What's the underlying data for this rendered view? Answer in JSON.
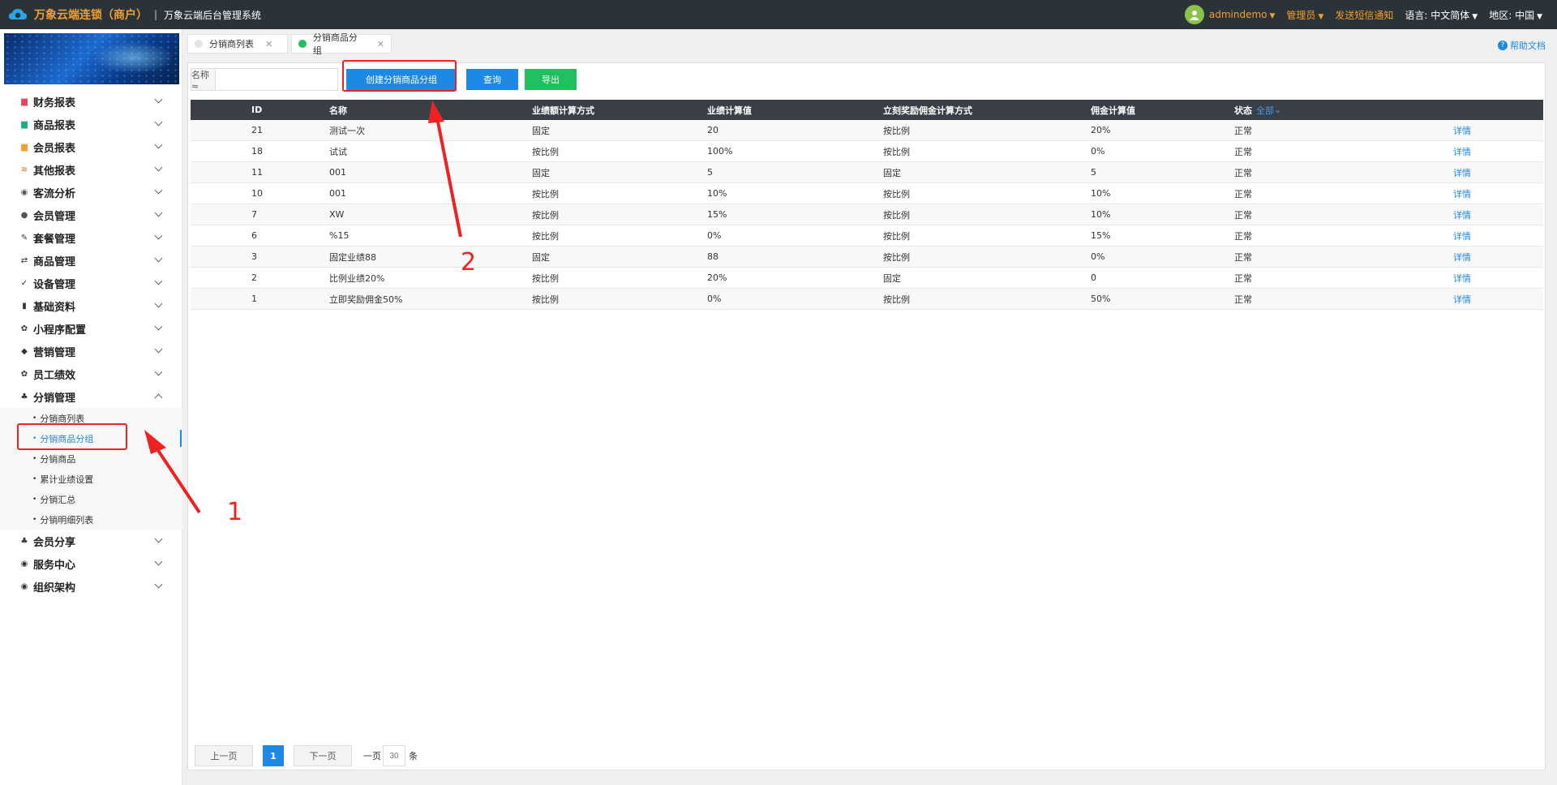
{
  "app": {
    "brand": "万象云端连锁（商户）",
    "separator": "|",
    "system_name": "万象云端后台管理系统"
  },
  "topbar": {
    "user": "admindemo",
    "role": "管理员",
    "sms_notice": "发送短信通知",
    "language_label": "语言:",
    "language_value": "中文简体",
    "region_label": "地区:",
    "region_value": "中国"
  },
  "sidebar": {
    "items": [
      {
        "label": "财务报表",
        "icon": "finance-report-icon"
      },
      {
        "label": "商品报表",
        "icon": "product-report-icon"
      },
      {
        "label": "会员报表",
        "icon": "member-report-icon"
      },
      {
        "label": "其他报表",
        "icon": "other-report-icon"
      },
      {
        "label": "客流分析",
        "icon": "traffic-analysis-icon"
      },
      {
        "label": "会员管理",
        "icon": "member-manage-icon"
      },
      {
        "label": "套餐管理",
        "icon": "package-manage-icon"
      },
      {
        "label": "商品管理",
        "icon": "product-manage-icon"
      },
      {
        "label": "设备管理",
        "icon": "device-manage-icon"
      },
      {
        "label": "基础资料",
        "icon": "basic-data-icon"
      },
      {
        "label": "小程序配置",
        "icon": "miniapp-config-icon"
      },
      {
        "label": "营销管理",
        "icon": "marketing-icon"
      },
      {
        "label": "员工绩效",
        "icon": "staff-performance-icon"
      },
      {
        "label": "分销管理",
        "icon": "distribution-icon"
      }
    ],
    "sub_items": [
      "分销商列表",
      "分销商品分组",
      "分销商品",
      "累计业绩设置",
      "分销汇总",
      "分销明细列表"
    ],
    "after_items": [
      {
        "label": "会员分享",
        "icon": "member-share-icon"
      },
      {
        "label": "服务中心",
        "icon": "service-center-icon"
      },
      {
        "label": "组织架构",
        "icon": "org-structure-icon"
      }
    ]
  },
  "tabs": [
    {
      "label": "分销商列表"
    },
    {
      "label": "分销商品分组"
    }
  ],
  "help": "帮助文档",
  "toolbar": {
    "search_label": "名称 ≈",
    "search_value": "",
    "create_label": "创建分销商品分组",
    "query_label": "查询",
    "export_label": "导出"
  },
  "table": {
    "columns": [
      "ID",
      "名称",
      "业绩额计算方式",
      "业绩计算值",
      "立刻奖励佣金计算方式",
      "佣金计算值",
      "状态"
    ],
    "status_filter": "全部",
    "rows": [
      [
        "21",
        "测试一次",
        "固定",
        "20",
        "按比例",
        "20%",
        "正常",
        "详情"
      ],
      [
        "18",
        "试试",
        "按比例",
        "100%",
        "按比例",
        "0%",
        "正常",
        "详情"
      ],
      [
        "11",
        "001",
        "固定",
        "5",
        "固定",
        "5",
        "正常",
        "详情"
      ],
      [
        "10",
        "001",
        "按比例",
        "10%",
        "按比例",
        "10%",
        "正常",
        "详情"
      ],
      [
        "7",
        "XW",
        "按比例",
        "15%",
        "按比例",
        "10%",
        "正常",
        "详情"
      ],
      [
        "6",
        "%15",
        "按比例",
        "0%",
        "按比例",
        "15%",
        "正常",
        "详情"
      ],
      [
        "3",
        "固定业绩88",
        "固定",
        "88",
        "按比例",
        "0%",
        "正常",
        "详情"
      ],
      [
        "2",
        "比例业绩20%",
        "按比例",
        "20%",
        "固定",
        "0",
        "正常",
        "详情"
      ],
      [
        "1",
        "立即奖励佣金50%",
        "按比例",
        "0%",
        "按比例",
        "50%",
        "正常",
        "详情"
      ]
    ]
  },
  "pager": {
    "prev": "上一页",
    "current": "1",
    "next": "下一页",
    "per_page_prefix": "一页",
    "per_page": "30",
    "per_page_suffix": "条"
  },
  "annotations": [
    "1",
    "2"
  ],
  "colors": {
    "topbar": "#2b3238",
    "brand": "#f0a030",
    "primary": "#1e88e5",
    "export": "#20c060",
    "annotation": "#ee2222"
  }
}
